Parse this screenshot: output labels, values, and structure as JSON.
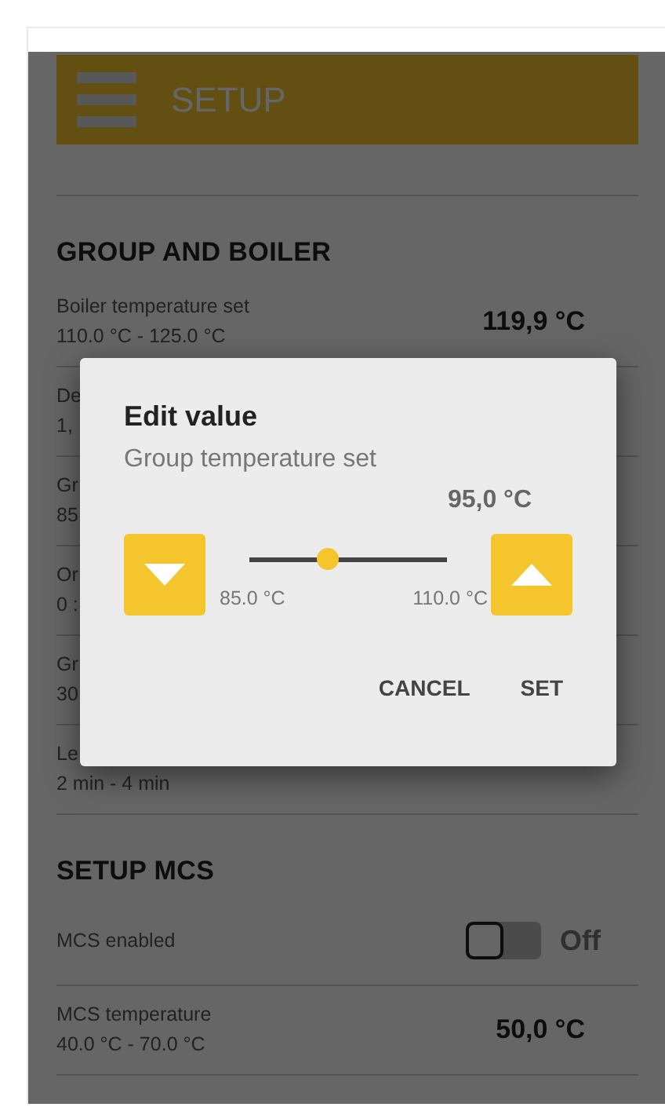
{
  "header": {
    "title": "SETUP"
  },
  "sections": [
    {
      "title": "GROUP AND BOILER",
      "rows": [
        {
          "kind": "value",
          "label": "Boiler temperature set",
          "range": "110.0 °C - 125.0 °C",
          "value": "119,9 °C"
        },
        {
          "kind": "value",
          "label": "De",
          "range": "1,"
        },
        {
          "kind": "value",
          "label": "Gr",
          "range": "85"
        },
        {
          "kind": "value",
          "label": "Or",
          "range": "0 :"
        },
        {
          "kind": "value",
          "label": "Gr",
          "range": "30"
        },
        {
          "kind": "value",
          "label": "Le",
          "range": "2 min - 4 min"
        }
      ]
    },
    {
      "title": "SETUP MCS",
      "rows": [
        {
          "kind": "toggle",
          "label": "MCS enabled",
          "on": false,
          "state_text": "Off"
        },
        {
          "kind": "value",
          "label": "MCS temperature",
          "range": "40.0 °C - 70.0 °C",
          "value": "50,0 °C"
        }
      ]
    }
  ],
  "dialog": {
    "title": "Edit value",
    "subtitle": "Group temperature set",
    "value": "95,0 °C",
    "slider": {
      "level": 0.4,
      "min_label": "85.0 °C",
      "max_label": "110.0 °C"
    },
    "buttons": [
      "CANCEL",
      "SET"
    ]
  }
}
